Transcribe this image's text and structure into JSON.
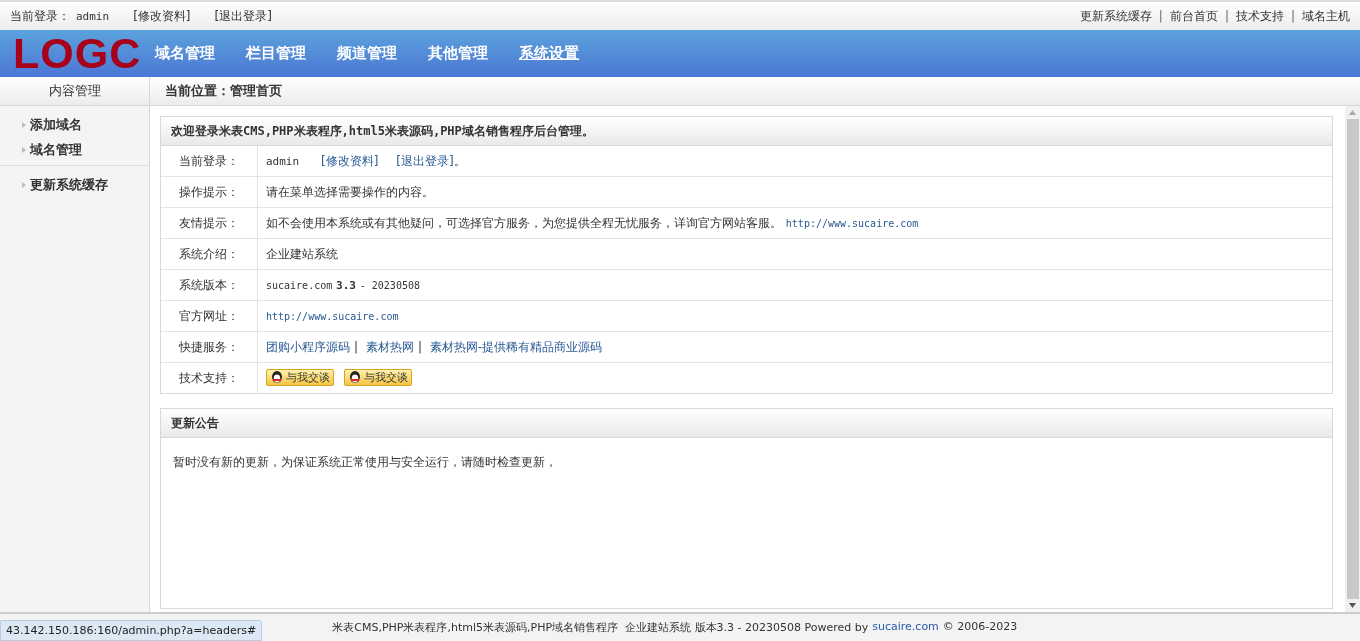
{
  "top_bar": {
    "login_label": "当前登录：",
    "user": "admin",
    "links": [
      "[修改资料]",
      "[退出登录]"
    ],
    "right_links": [
      "更新系统缓存",
      "前台首页",
      "技术支持",
      "域名主机"
    ],
    "separator": "|"
  },
  "header": {
    "logo": "LOGC",
    "nav": [
      {
        "label": "域名管理",
        "selected": false
      },
      {
        "label": "栏目管理",
        "selected": false
      },
      {
        "label": "频道管理",
        "selected": false
      },
      {
        "label": "其他管理",
        "selected": false
      },
      {
        "label": "系统设置",
        "selected": true
      }
    ]
  },
  "sidebar": {
    "title": "内容管理",
    "groups": [
      [
        "添加域名",
        "域名管理"
      ],
      [
        "更新系统缓存"
      ]
    ]
  },
  "breadcrumb": "当前位置：管理首页",
  "welcome_panel": {
    "title": "欢迎登录米表CMS,PHP米表程序,html5米表源码,PHP域名销售程序后台管理。",
    "rows": [
      {
        "label": "当前登录：",
        "kind": "login",
        "user": "admin",
        "links": [
          "[修改资料]",
          "[退出登录]"
        ],
        "suffix": "。"
      },
      {
        "label": "操作提示：",
        "kind": "text",
        "text": "请在菜单选择需要操作的内容。"
      },
      {
        "label": "友情提示：",
        "kind": "text_link",
        "text": "如不会使用本系统或有其他疑问，可选择官方服务，为您提供全程无忧服务，详询官方网站客服。",
        "link": "http://www.sucaire.com"
      },
      {
        "label": "系统介绍：",
        "kind": "text",
        "text": "企业建站系统"
      },
      {
        "label": "系统版本：",
        "kind": "version",
        "text": "sucaire.com",
        "version": "3.3",
        "date": "- 20230508"
      },
      {
        "label": "官方网址：",
        "kind": "link",
        "link": "http://www.sucaire.com"
      },
      {
        "label": "快捷服务：",
        "kind": "links",
        "links": [
          "团购小程序源码",
          "素材热网",
          "素材热网-提供稀有精品商业源码"
        ],
        "separator": "|"
      },
      {
        "label": "技术支持：",
        "kind": "qq",
        "buttons": [
          "与我交谈",
          "与我交谈"
        ]
      }
    ]
  },
  "notice_panel": {
    "title": "更新公告",
    "text": "暂时没有新的更新，为保证系统正常使用与安全运行，请随时检查更新，"
  },
  "footer": {
    "text": "米表CMS,PHP米表程序,html5米表源码,PHP域名销售程序  企业建站系统 版本3.3 - 20230508 Powered by",
    "link": "sucaire.com",
    "copyright": "© 2006-2023"
  },
  "status_url": "43.142.150.186:160/admin.php?a=headers#"
}
